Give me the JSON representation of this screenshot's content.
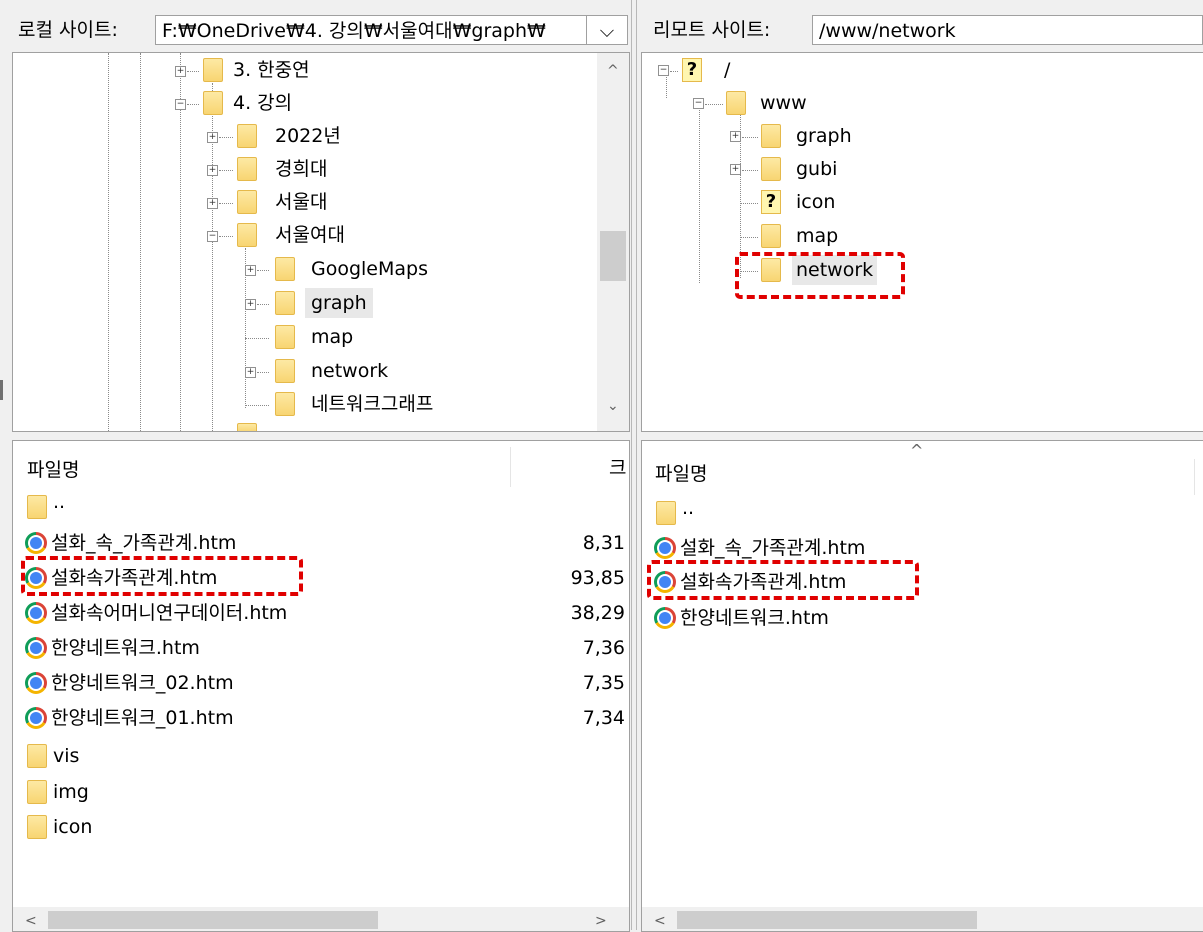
{
  "local": {
    "address_label": "로컬 사이트:",
    "address_value": "F:₩OneDrive₩4. 강의₩서울여대₩graph₩",
    "dropdown_glyph": "⌵",
    "tree": [
      {
        "label": "3. 한중연",
        "expander": "+"
      },
      {
        "label": "4. 강의",
        "expander": "−"
      },
      {
        "label": "2022년",
        "expander": "+"
      },
      {
        "label": "경희대",
        "expander": "+"
      },
      {
        "label": "서울대",
        "expander": "+"
      },
      {
        "label": "서울여대",
        "expander": "−"
      },
      {
        "label": "GoogleMaps",
        "expander": "+"
      },
      {
        "label": "graph",
        "expander": "+"
      },
      {
        "label": "map",
        "expander": ""
      },
      {
        "label": "network",
        "expander": "+"
      },
      {
        "label": "네트워크그래프",
        "expander": ""
      }
    ],
    "files_header": {
      "name": "파일명",
      "size": "크"
    },
    "files": [
      {
        "name": "..",
        "type": "folder",
        "size": ""
      },
      {
        "name": "설화_속_가족관계.htm",
        "type": "chrome",
        "size": "8,31"
      },
      {
        "name": "설화속가족관계.htm",
        "type": "chrome",
        "size": "93,85"
      },
      {
        "name": "설화속어머니연구데이터.htm",
        "type": "chrome",
        "size": "38,29"
      },
      {
        "name": "한양네트워크.htm",
        "type": "chrome",
        "size": "7,36"
      },
      {
        "name": "한양네트워크_02.htm",
        "type": "chrome",
        "size": "7,35"
      },
      {
        "name": "한양네트워크_01.htm",
        "type": "chrome",
        "size": "7,34"
      },
      {
        "name": "vis",
        "type": "folder",
        "size": ""
      },
      {
        "name": "img",
        "type": "folder",
        "size": ""
      },
      {
        "name": "icon",
        "type": "folder",
        "size": ""
      }
    ]
  },
  "remote": {
    "address_label": "리모트 사이트:",
    "address_value": "/www/network",
    "tree": [
      {
        "label": "/",
        "expander": "−",
        "icon": "question"
      },
      {
        "label": "www",
        "expander": "−",
        "icon": "folder"
      },
      {
        "label": "graph",
        "expander": "+",
        "icon": "folder"
      },
      {
        "label": "gubi",
        "expander": "+",
        "icon": "folder"
      },
      {
        "label": "icon",
        "expander": "",
        "icon": "question"
      },
      {
        "label": "map",
        "expander": "",
        "icon": "folder"
      },
      {
        "label": "network",
        "expander": "",
        "icon": "folder"
      }
    ],
    "files_header": {
      "name": "파일명",
      "sort_glyph": "^"
    },
    "files": [
      {
        "name": "..",
        "type": "folder"
      },
      {
        "name": "설화_속_가족관계.htm",
        "type": "chrome"
      },
      {
        "name": "설화속가족관계.htm",
        "type": "chrome"
      },
      {
        "name": "한양네트워크.htm",
        "type": "chrome"
      }
    ]
  },
  "scroll": {
    "up": "^",
    "down": "⌄",
    "left": "<",
    "right": ">"
  },
  "colors": {
    "highlight": "#e00000",
    "selected_bg": "#e8e8e8"
  }
}
